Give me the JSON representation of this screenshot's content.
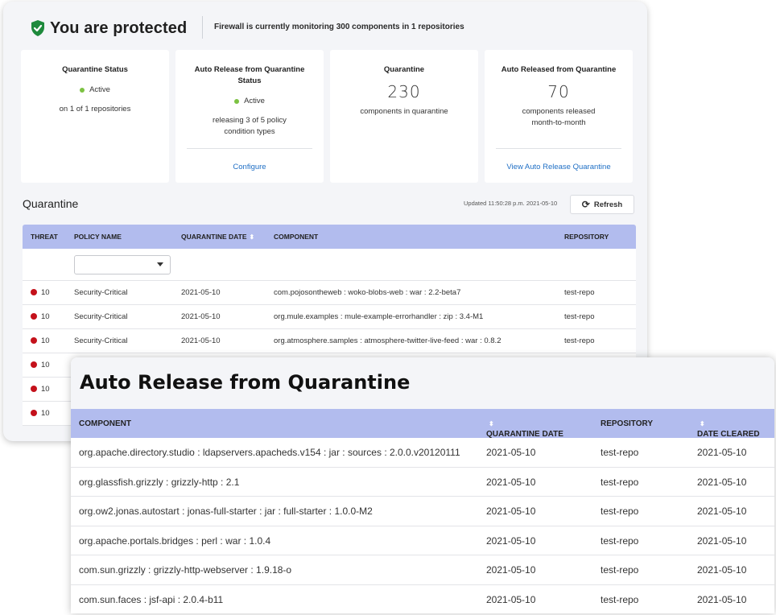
{
  "header": {
    "title": "You are protected",
    "monitoring": "Firewall is currently monitoring 300 components in 1 repositories"
  },
  "cards": [
    {
      "title": "Quarantine Status",
      "status": "Active",
      "text": "on 1 of 1 repositories"
    },
    {
      "title": "Auto Release from Quarantine Status",
      "status": "Active",
      "text": "releasing 3 of 5 policy condition types",
      "link": "Configure"
    },
    {
      "title": "Quarantine",
      "value": "230",
      "text": "components in quarantine"
    },
    {
      "title": "Auto Released from Quarantine",
      "value": "70",
      "text": "components released month-to-month",
      "link": "View Auto Release Quarantine"
    }
  ],
  "quarantine": {
    "heading": "Quarantine",
    "updated": "Updated 11:50:28 p.m. 2021-05-10",
    "refresh_label": "Refresh",
    "columns": {
      "threat": "THREAT",
      "policy": "POLICY NAME",
      "date": "QUARANTINE DATE",
      "component": "COMPONENT",
      "repository": "REPOSITORY"
    },
    "rows": [
      {
        "threat": "10",
        "policy": "Security-Critical",
        "date": "2021-05-10",
        "component": "com.pojosontheweb : woko-blobs-web : war : 2.2-beta7",
        "repository": "test-repo"
      },
      {
        "threat": "10",
        "policy": "Security-Critical",
        "date": "2021-05-10",
        "component": "org.mule.examples : mule-example-errorhandler : zip : 3.4-M1",
        "repository": "test-repo"
      },
      {
        "threat": "10",
        "policy": "Security-Critical",
        "date": "2021-05-10",
        "component": "org.atmosphere.samples : atmosphere-twitter-live-feed : war : 0.8.2",
        "repository": "test-repo"
      },
      {
        "threat": "10"
      },
      {
        "threat": "10"
      },
      {
        "threat": "10"
      }
    ]
  },
  "auto_release": {
    "title": "Auto Release from Quarantine",
    "columns": {
      "component": "COMPONENT",
      "date": "QUARANTINE DATE",
      "repository": "REPOSITORY",
      "cleared": "DATE CLEARED"
    },
    "rows": [
      {
        "component": "org.apache.directory.studio : ldapservers.apacheds.v154 : jar : sources : 2.0.0.v20120111",
        "date": "2021-05-10",
        "repository": "test-repo",
        "cleared": "2021-05-10"
      },
      {
        "component": "org.glassfish.grizzly : grizzly-http : 2.1",
        "date": "2021-05-10",
        "repository": "test-repo",
        "cleared": "2021-05-10"
      },
      {
        "component": "org.ow2.jonas.autostart : jonas-full-starter : jar : full-starter : 1.0.0-M2",
        "date": "2021-05-10",
        "repository": "test-repo",
        "cleared": "2021-05-10"
      },
      {
        "component": "org.apache.portals.bridges : perl : war : 1.0.4",
        "date": "2021-05-10",
        "repository": "test-repo",
        "cleared": "2021-05-10"
      },
      {
        "component": "com.sun.grizzly : grizzly-http-webserver : 1.9.18-o",
        "date": "2021-05-10",
        "repository": "test-repo",
        "cleared": "2021-05-10"
      },
      {
        "component": "com.sun.faces : jsf-api : 2.0.4-b11",
        "date": "2021-05-10",
        "repository": "test-repo",
        "cleared": "2021-05-10"
      }
    ]
  },
  "colors": {
    "accent_header": "#b2bcee",
    "status_active": "#7cc242",
    "threat_critical": "#c4111b",
    "link": "#1f6fc5",
    "shield": "#1e8a3c"
  },
  "icons": {
    "shield": "shield-check-icon",
    "refresh": "refresh-icon",
    "sort": "sort-icon",
    "dropdown": "chevron-down-icon"
  }
}
